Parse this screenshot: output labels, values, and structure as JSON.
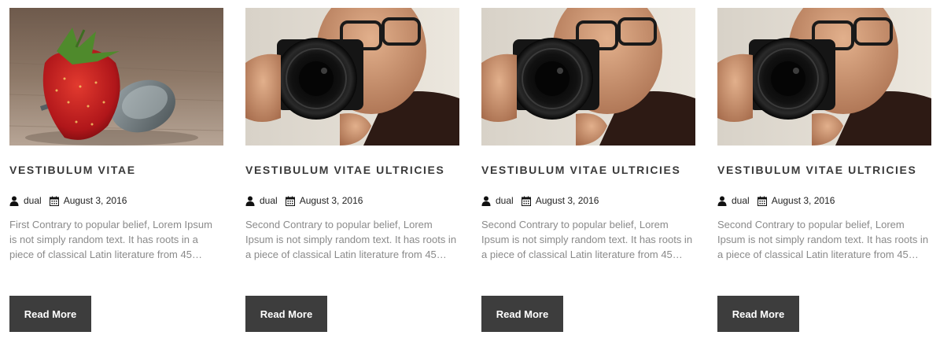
{
  "posts": [
    {
      "title": "VESTIBULUM VITAE",
      "author": "dual",
      "date": "August 3, 2016",
      "excerpt": "First Contrary to popular belief, Lorem Ipsum is not simply random text. It has roots in a piece of classical Latin literature from 45…",
      "button": "Read More",
      "image": "strawberry-spoon"
    },
    {
      "title": "VESTIBULUM VITAE ULTRICIES",
      "author": "dual",
      "date": "August 3, 2016",
      "excerpt": "Second Contrary to popular belief, Lorem Ipsum is not simply random text. It has roots in a piece of classical Latin literature from 45…",
      "button": "Read More",
      "image": "photographer-camera"
    },
    {
      "title": "VESTIBULUM VITAE ULTRICIES",
      "author": "dual",
      "date": "August 3, 2016",
      "excerpt": "Second Contrary to popular belief, Lorem Ipsum is not simply random text. It has roots in a piece of classical Latin literature from 45…",
      "button": "Read More",
      "image": "photographer-camera"
    },
    {
      "title": "VESTIBULUM VITAE ULTRICIES",
      "author": "dual",
      "date": "August 3, 2016",
      "excerpt": "Second Contrary to popular belief, Lorem Ipsum is not simply random text. It has roots in a piece of classical Latin literature from 45…",
      "button": "Read More",
      "image": "photographer-camera"
    }
  ],
  "icons": {
    "author": "user-icon",
    "date": "calendar-icon"
  },
  "colors": {
    "button_bg": "#3d3d3d",
    "title": "#3a3a3a",
    "excerpt": "#8a8a8a"
  }
}
